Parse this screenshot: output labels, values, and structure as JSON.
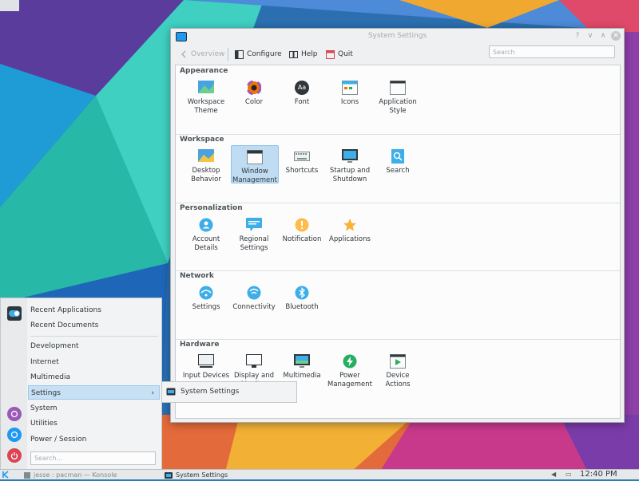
{
  "window": {
    "title": "System Settings",
    "buttons": {
      "help": "?",
      "minimize": "∨",
      "maximize": "∧",
      "close": "✕"
    }
  },
  "toolbar": {
    "overview_label": "Overview",
    "configure_label": "Configure",
    "help_label": "Help",
    "quit_label": "Quit",
    "search_placeholder": "Search"
  },
  "sections": [
    {
      "title": "Appearance",
      "items": [
        {
          "label": "Workspace Theme",
          "icon": "workspace-theme-icon"
        },
        {
          "label": "Color",
          "icon": "color-icon"
        },
        {
          "label": "Font",
          "icon": "font-icon",
          "glyph": "Aa"
        },
        {
          "label": "Icons",
          "icon": "icons-icon"
        },
        {
          "label": "Application Style",
          "icon": "application-style-icon"
        }
      ]
    },
    {
      "title": "Workspace",
      "items": [
        {
          "label": "Desktop Behavior",
          "icon": "desktop-behavior-icon"
        },
        {
          "label": "Window Management",
          "icon": "window-management-icon",
          "selected": true
        },
        {
          "label": "Shortcuts",
          "icon": "shortcuts-icon"
        },
        {
          "label": "Startup and Shutdown",
          "icon": "startup-shutdown-icon"
        },
        {
          "label": "Search",
          "icon": "search-icon"
        }
      ]
    },
    {
      "title": "Personalization",
      "items": [
        {
          "label": "Account Details",
          "icon": "account-details-icon"
        },
        {
          "label": "Regional Settings",
          "icon": "regional-settings-icon"
        },
        {
          "label": "Notification",
          "icon": "notification-icon"
        },
        {
          "label": "Applications",
          "icon": "applications-icon"
        }
      ]
    },
    {
      "title": "Network",
      "items": [
        {
          "label": "Settings",
          "icon": "network-settings-icon"
        },
        {
          "label": "Connectivity",
          "icon": "connectivity-icon"
        },
        {
          "label": "Bluetooth",
          "icon": "bluetooth-icon"
        }
      ]
    },
    {
      "title": "Hardware",
      "items": [
        {
          "label": "Input Devices",
          "icon": "input-devices-icon"
        },
        {
          "label": "Display and Monitor",
          "icon": "display-monitor-icon"
        },
        {
          "label": "Multimedia",
          "icon": "multimedia-icon"
        },
        {
          "label": "Power Management",
          "icon": "power-management-icon"
        },
        {
          "label": "Device Actions",
          "icon": "device-actions-icon"
        }
      ]
    }
  ],
  "launcher": {
    "items": [
      {
        "label": "Recent Applications"
      },
      {
        "label": "Recent Documents"
      },
      {
        "label": "Development"
      },
      {
        "label": "Internet"
      },
      {
        "label": "Multimedia"
      },
      {
        "label": "Settings",
        "highlighted": true,
        "arrow": "›"
      },
      {
        "label": "System"
      },
      {
        "label": "Utilities"
      },
      {
        "label": "Power / Session"
      }
    ],
    "search_placeholder": "Search...",
    "submenu": {
      "label": "System Settings"
    }
  },
  "taskbar": {
    "tasks": [
      {
        "label": "jesse : pacman — Konsole",
        "active": false
      },
      {
        "label": "System Settings",
        "active": true
      }
    ],
    "clock": "12:40 PM"
  },
  "colors": {
    "accent": "#1d99f3",
    "selection": "#bfdcf3",
    "window_bg": "#eff0f1",
    "content_bg": "#fcfcfc"
  }
}
